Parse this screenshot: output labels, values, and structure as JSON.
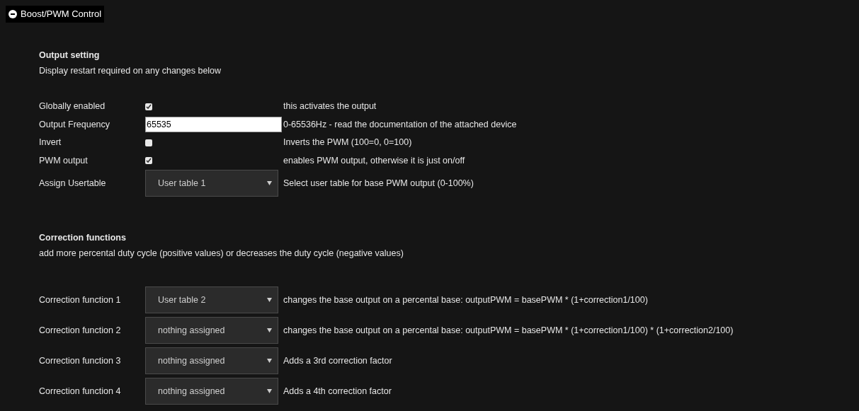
{
  "panel": {
    "title": "Boost/PWM Control",
    "expanded": true
  },
  "sections": [
    {
      "heading": "Output setting",
      "note": "Display restart required on any changes below",
      "rows": [
        {
          "kind": "checkbox",
          "label": "Globally enabled",
          "checked": true,
          "description": "this activates the output"
        },
        {
          "kind": "text",
          "label": "Output Frequency",
          "value": "65535",
          "description": "0-65536Hz - read the documentation of the attached device"
        },
        {
          "kind": "checkbox",
          "label": "Invert",
          "checked": false,
          "description": "Inverts the PWM (100=0, 0=100)"
        },
        {
          "kind": "checkbox",
          "label": "PWM output",
          "checked": true,
          "description": "enables PWM output, otherwise it is just on/off"
        },
        {
          "kind": "select",
          "label": "Assign Usertable",
          "value": "User table 1",
          "description": "Select user table for base PWM output (0-100%)"
        }
      ]
    },
    {
      "heading": "Correction functions",
      "note": "add more percental duty cycle (positive values) or decreases the duty cycle (negative values)",
      "rows": [
        {
          "kind": "select",
          "label": "Correction function 1",
          "value": "User table 2",
          "description": "changes the base output on a percental base: outputPWM = basePWM * (1+correction1/100)"
        },
        {
          "kind": "select",
          "label": "Correction function 2",
          "value": "nothing assigned",
          "description": "changes the base output on a percental base: outputPWM = basePWM * (1+correction1/100) * (1+correction2/100)"
        },
        {
          "kind": "select",
          "label": "Correction function 3",
          "value": "nothing assigned",
          "description": "Adds a 3rd correction factor"
        },
        {
          "kind": "select",
          "label": "Correction function 4",
          "value": "nothing assigned",
          "description": "Adds a 4th correction factor"
        }
      ]
    }
  ]
}
